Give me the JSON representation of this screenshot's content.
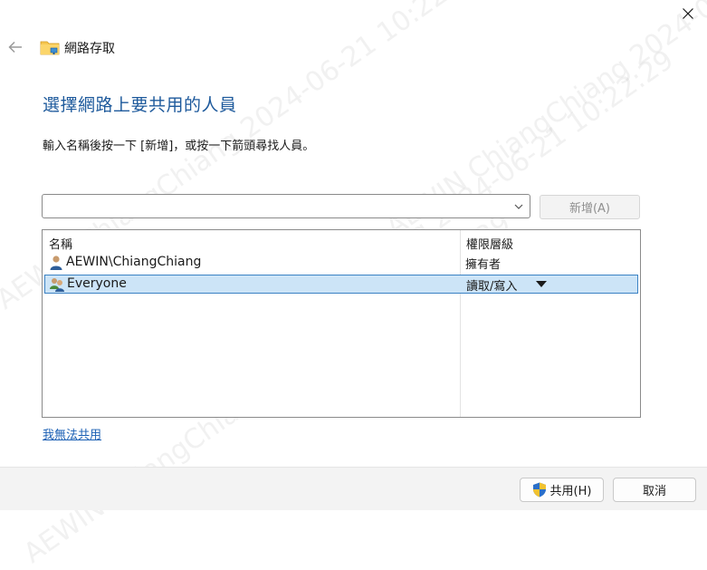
{
  "window": {
    "title": "網路存取"
  },
  "heading": "選擇網路上要共用的人員",
  "instruction": "輸入名稱後按一下 [新增]，或按一下箭頭尋找人員。",
  "name_input": {
    "value": "",
    "placeholder": ""
  },
  "add_button": {
    "label": "新增(A)",
    "enabled": false
  },
  "list": {
    "columns": [
      "名稱",
      "權限層級"
    ],
    "rows": [
      {
        "name": "AEWIN\\ChiangChiang",
        "permission": "擁有者",
        "icon": "user-icon",
        "selected": false
      },
      {
        "name": "Everyone",
        "permission": "讀取/寫入",
        "icon": "group-icon",
        "selected": true
      }
    ]
  },
  "cant_share_link": "我無法共用",
  "footer": {
    "share_label": "共用(H)",
    "share_icon": "uac-shield-icon",
    "cancel_label": "取消"
  },
  "watermark": {
    "text": "AEWIN ChiangChiang 2024-06-21 10:22:29"
  },
  "colors": {
    "heading": "#1e5a9c",
    "link": "#1a5fb4",
    "selection_bg": "#cce4f7",
    "selection_border": "#3b82c4"
  }
}
